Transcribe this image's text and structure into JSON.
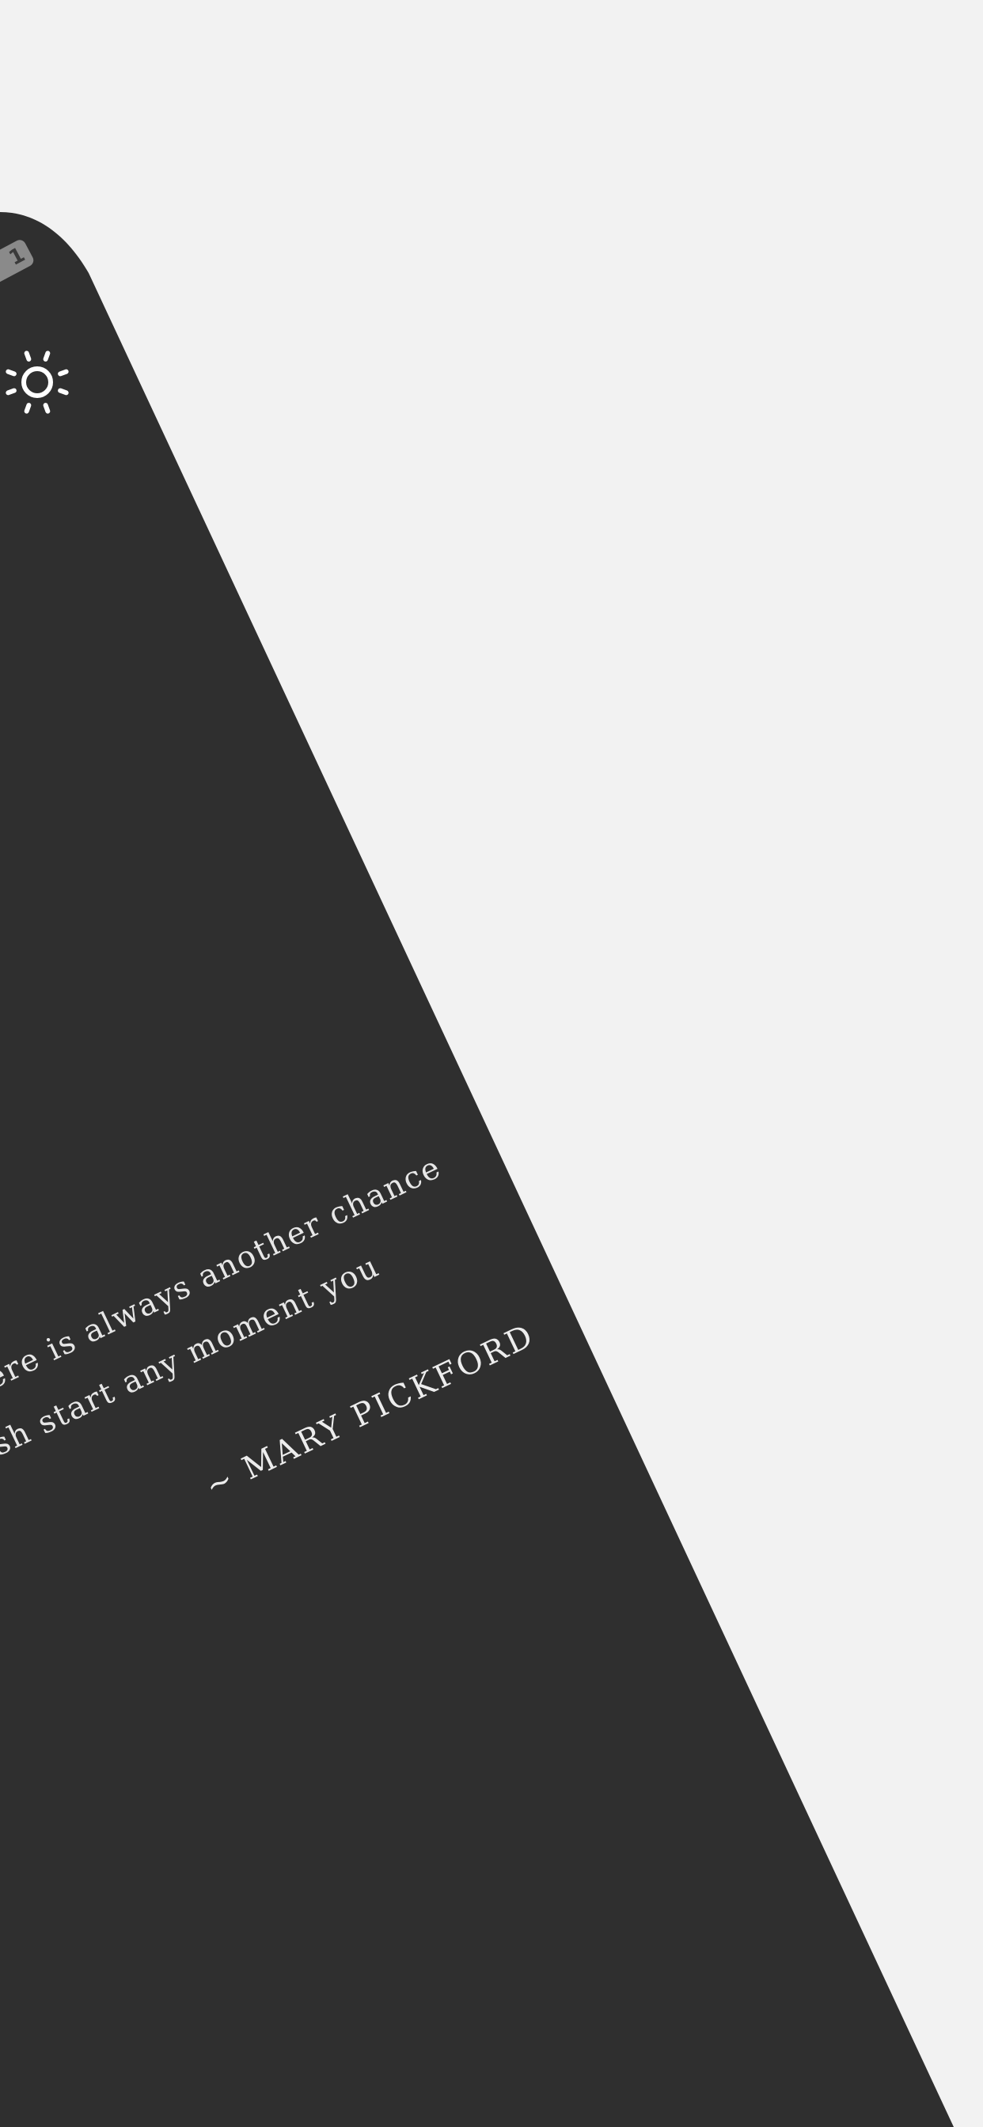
{
  "colors": {
    "page_background": "#f2f2f2",
    "card_background": "#2f2f2f",
    "text": "#e7e7e7",
    "badge": "#8a8a8a"
  },
  "badge": {
    "text": "1"
  },
  "icons": {
    "brightness": "sun-icon"
  },
  "quote": {
    "line1": "here is always another chance",
    "line2": "esh start any moment you",
    "author": "~ MARY PICKFORD"
  }
}
